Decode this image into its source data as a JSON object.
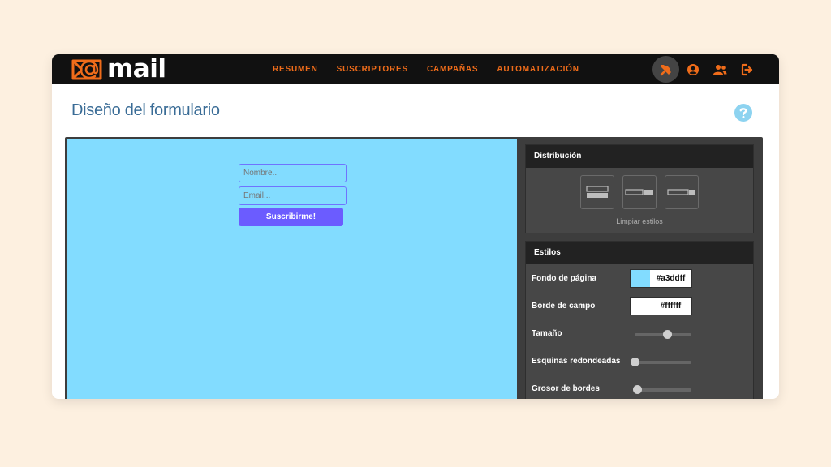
{
  "app": {
    "logo_text": "mail"
  },
  "nav": {
    "items": [
      {
        "label": "RESUMEN"
      },
      {
        "label": "SUSCRIPTORES"
      },
      {
        "label": "CAMPAÑAS"
      },
      {
        "label": "AUTOMATIZACIÓN"
      }
    ]
  },
  "top_icons": [
    "tools-icon",
    "user-circle-icon",
    "users-icon",
    "logout-icon"
  ],
  "page": {
    "title": "Diseño del formulario",
    "help_icon": "question-circle-icon"
  },
  "preview": {
    "name_placeholder": "Nombre...",
    "email_placeholder": "Email...",
    "submit_label": "Suscribirme!"
  },
  "distribution": {
    "header": "Distribución",
    "options": [
      "stacked-layout",
      "inline-small-button",
      "inline-wide-field"
    ],
    "clear_label": "Limpiar estilos"
  },
  "styles": {
    "header": "Estilos",
    "page_background_label": "Fondo de página",
    "page_background_value": "#a3ddff",
    "field_border_label": "Borde de campo",
    "field_border_value": "#ffffff",
    "size_label": "Tamaño",
    "size_level": 0.57,
    "rounded_corners_label": "Esquinas redondeadas",
    "rounded_corners_level": 0.0,
    "border_thickness_label": "Grosor de bordes",
    "border_thickness_level": 0.04
  },
  "colors": {
    "accent": "#ef6c1a",
    "topbar": "#111111",
    "preview_bg": "#82dcff",
    "button": "#6b5cff",
    "title": "#3a6c96",
    "help": "#8dd3f0"
  }
}
